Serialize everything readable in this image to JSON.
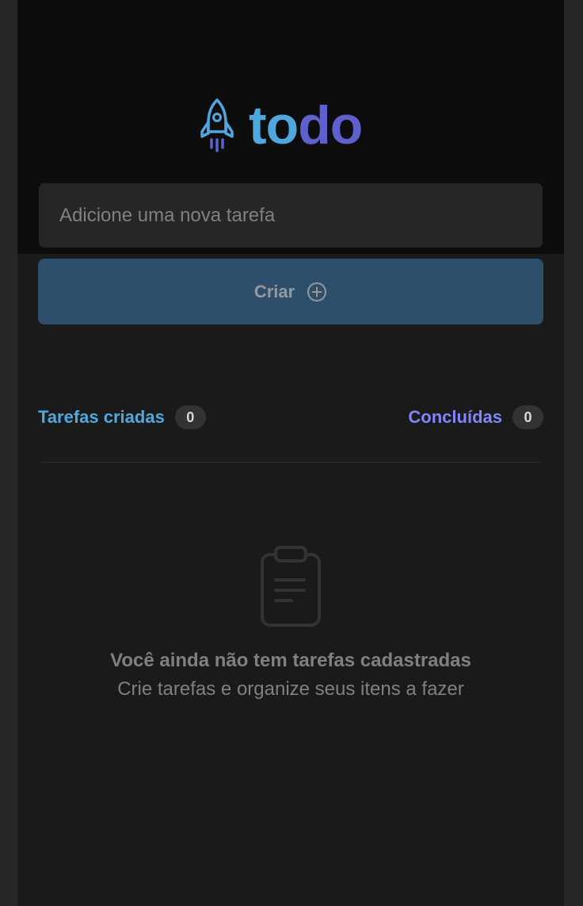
{
  "brand": {
    "text_to": "to",
    "text_do": "do",
    "colors": {
      "blue": "#4ea8de",
      "purple": "#5e60ce",
      "purple_light": "#8284fa"
    },
    "icon": "rocket-icon"
  },
  "new_task": {
    "placeholder": "Adicione uma nova tarefa",
    "value": ""
  },
  "create_button": {
    "label": "Criar",
    "icon": "plus-circle-icon"
  },
  "counters": {
    "created": {
      "label": "Tarefas criadas",
      "count": "0"
    },
    "done": {
      "label": "Concluídas",
      "count": "0"
    }
  },
  "empty_state": {
    "icon": "clipboard-icon",
    "title": "Você ainda não tem tarefas cadastradas",
    "subtitle": "Crie tarefas e organize seus itens a fazer"
  }
}
